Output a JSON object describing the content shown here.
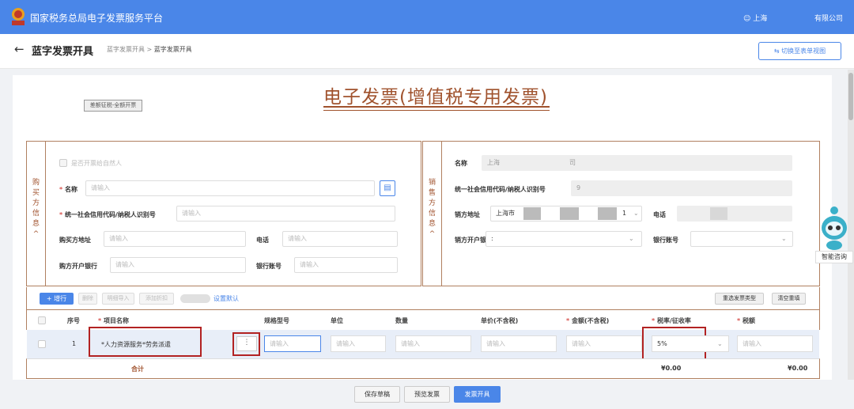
{
  "header": {
    "site_title": "国家税务总局电子发票服务平台",
    "user": "上海",
    "company": "有限公司",
    "logo_text": "税务"
  },
  "subheader": {
    "back_icon": "arrow-left-icon",
    "page_title": "蓝字发票开具",
    "breadcrumb_parent": "蓝字发票开具",
    "breadcrumb_sep": ">",
    "breadcrumb_current": "蓝字发票开具",
    "switch_button": "切换至表单视图"
  },
  "invoice": {
    "title": "电子发票(增值税专用发票)",
    "tag": "差额征税-全额开票"
  },
  "buyer": {
    "side_label": [
      "购",
      "买",
      "方",
      "信",
      "息",
      "^"
    ],
    "natural_person_checkbox": "是否开票给自然人",
    "name_label": "名称",
    "name_placeholder": "请输入",
    "tax_id_label": "统一社会信用代码/纳税人识别号",
    "tax_id_placeholder": "请输入",
    "address_label": "购买方地址",
    "address_placeholder": "请输入",
    "phone_label": "电话",
    "phone_placeholder": "请输入",
    "bank_label": "购方开户银行",
    "bank_placeholder": "请输入",
    "account_label": "银行账号",
    "account_placeholder": "请输入"
  },
  "seller": {
    "side_label": [
      "销",
      "售",
      "方",
      "信",
      "息",
      "^"
    ],
    "name_label": "名称",
    "name_value": "上海",
    "name_value_tail": "司",
    "tax_id_label": "统一社会信用代码/纳税人识别号",
    "tax_id_value": "9",
    "address_label": "销方地址",
    "address_value": "上海市",
    "address_suffix": "1",
    "phone_label": "电话",
    "bank_label": "销方开户银行",
    "bank_value": ":",
    "account_label": "银行账号"
  },
  "toolbar": {
    "add_row": "+ 增行",
    "delete": "删除",
    "detail_import": "明细导入",
    "add_discount": "添加折扣",
    "set_default": "设置默认",
    "reselect_type": "重选发票类型",
    "clear_reset": "清空重填"
  },
  "table": {
    "headers": {
      "index": "序号",
      "item_name": "项目名称",
      "spec": "规格型号",
      "unit": "单位",
      "quantity": "数量",
      "unit_price": "单价(不含税)",
      "amount": "金额(不含税)",
      "tax_rate": "税率/征收率",
      "tax": "税额"
    },
    "rows": [
      {
        "index": "1",
        "item_name": "*人力资源服务*劳务派遣",
        "more": "⋮",
        "spec_placeholder": "请输入",
        "unit_placeholder": "请输入",
        "quantity_placeholder": "请输入",
        "unit_price_placeholder": "请输入",
        "amount_placeholder": "请输入",
        "tax_rate": "5%",
        "tax_placeholder": "请输入"
      }
    ],
    "total_label": "合计",
    "total_amount": "¥0.00",
    "total_tax": "¥0.00"
  },
  "footer": {
    "save_draft": "保存草稿",
    "preview": "预览发票",
    "issue": "发票开具"
  },
  "assistant": {
    "label": "智能咨询"
  },
  "colors": {
    "primary": "#4a86e8",
    "invoice_brown": "#a0522d",
    "highlight_red": "#b22222"
  }
}
